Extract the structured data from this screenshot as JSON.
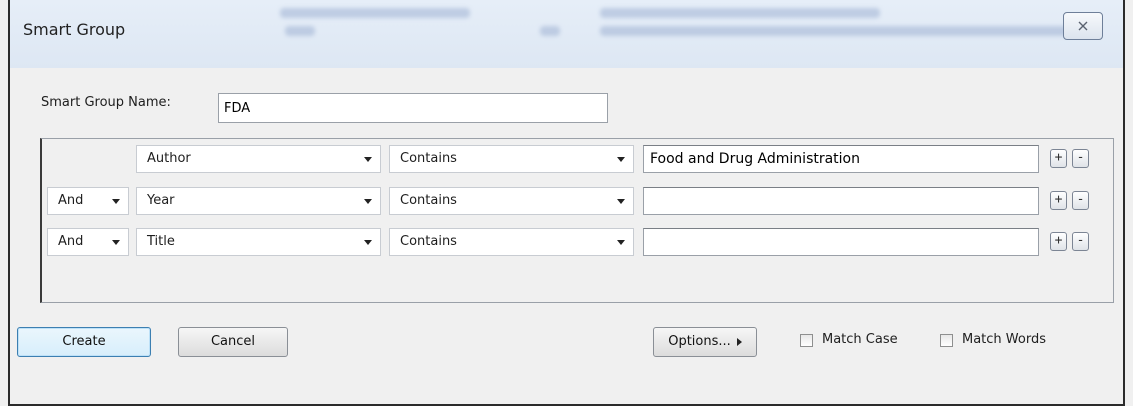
{
  "window": {
    "title": "Smart Group",
    "close_icon": "close-icon"
  },
  "form": {
    "name_label": "Smart Group Name:",
    "name_value": "FDA"
  },
  "criteria": [
    {
      "connector": "",
      "field": "Author",
      "operator": "Contains",
      "value": "Food and Drug Administration",
      "add_label": "+",
      "remove_label": "-"
    },
    {
      "connector": "And",
      "field": "Year",
      "operator": "Contains",
      "value": "",
      "add_label": "+",
      "remove_label": "-"
    },
    {
      "connector": "And",
      "field": "Title",
      "operator": "Contains",
      "value": "",
      "add_label": "+",
      "remove_label": "-"
    }
  ],
  "buttons": {
    "create": "Create",
    "cancel": "Cancel",
    "options": "Options..."
  },
  "checkboxes": {
    "match_case": {
      "label": "Match Case",
      "checked": false
    },
    "match_words": {
      "label": "Match Words",
      "checked": false
    }
  },
  "colors": {
    "default_button_border": "#3c7fb1",
    "titlebar": "#dde7f3"
  }
}
